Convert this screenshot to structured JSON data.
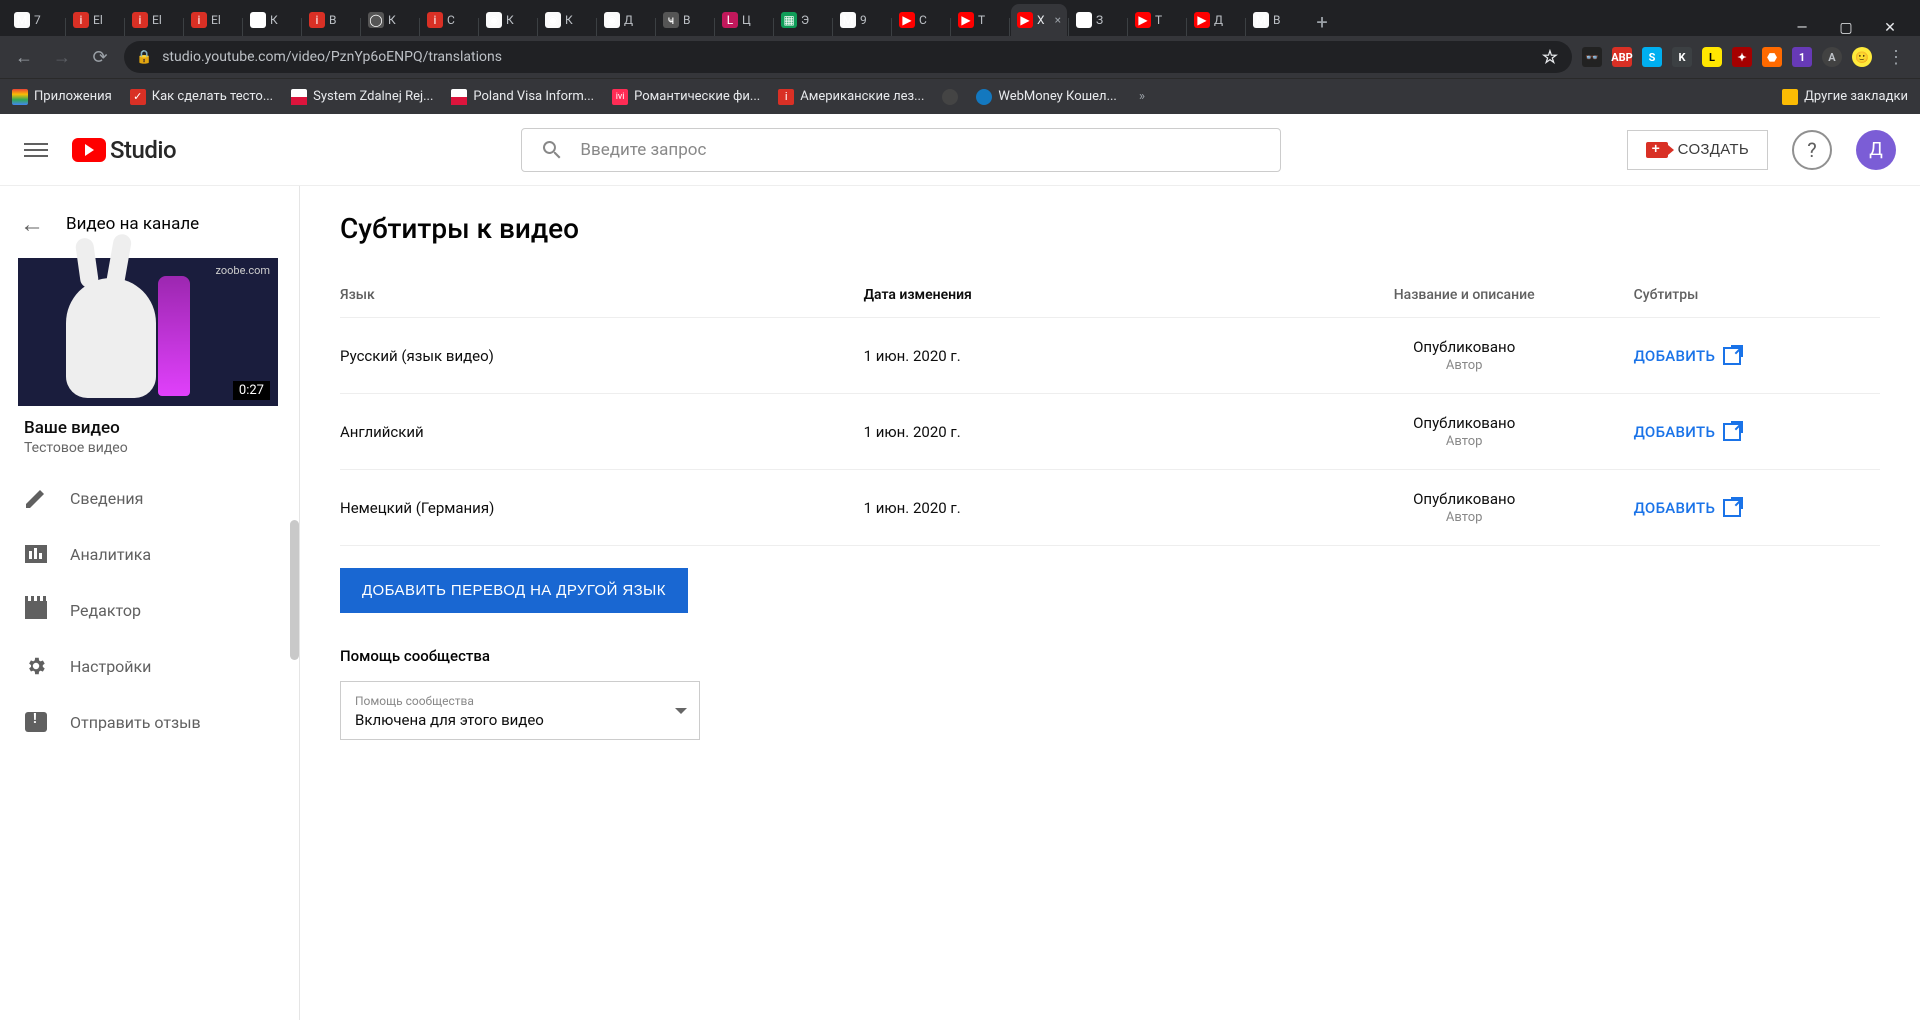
{
  "chrome": {
    "tabs": [
      {
        "fav": "M",
        "color": "#fff",
        "bg": "#fafafa",
        "label": "7"
      },
      {
        "fav": "i",
        "bg": "#d93025",
        "label": "El"
      },
      {
        "fav": "i",
        "bg": "#d93025",
        "label": "El"
      },
      {
        "fav": "i",
        "bg": "#d93025",
        "label": "El"
      },
      {
        "fav": "M",
        "bg": "#fff",
        "label": "К"
      },
      {
        "fav": "i",
        "bg": "#d93025",
        "label": "В"
      },
      {
        "fav": "◯",
        "bg": "#555",
        "label": "К"
      },
      {
        "fav": "i",
        "bg": "#d93025",
        "label": "С"
      },
      {
        "fav": "◉",
        "bg": "#fafafa",
        "label": "К"
      },
      {
        "fav": "◉",
        "bg": "#fafafa",
        "label": "К"
      },
      {
        "fav": "◉",
        "bg": "#fafafa",
        "label": "Д"
      },
      {
        "fav": "ҹ",
        "bg": "#555",
        "label": "В"
      },
      {
        "fav": "L",
        "bg": "#c2185b",
        "label": "Ц"
      },
      {
        "fav": "▦",
        "bg": "#0f9d58",
        "label": "Э"
      },
      {
        "fav": "M",
        "bg": "#fafafa",
        "label": "9"
      },
      {
        "fav": "▶",
        "bg": "#ff0000",
        "label": "С"
      },
      {
        "fav": "▶",
        "bg": "#ff0000",
        "label": "T"
      },
      {
        "fav": "▶",
        "bg": "#ff0000",
        "label": "X",
        "active": true
      },
      {
        "fav": "G",
        "bg": "#fff",
        "label": "З"
      },
      {
        "fav": "▶",
        "bg": "#ff0000",
        "label": "Т"
      },
      {
        "fav": "▶",
        "bg": "#ff0000",
        "label": "Д"
      },
      {
        "fav": "M",
        "bg": "#fafafa",
        "label": "В"
      }
    ],
    "url": "studio.youtube.com/video/PznYp6oENPQ/translations",
    "bookmarks": {
      "apps": "Приложения",
      "items": [
        {
          "icon": "check",
          "label": "Как сделать тесто..."
        },
        {
          "icon": "pl",
          "label": "System Zdalnej Rej..."
        },
        {
          "icon": "pl",
          "label": "Poland Visa Inform..."
        },
        {
          "icon": "ivi",
          "label": "Романтические фи..."
        },
        {
          "icon": "i",
          "label": "Американские лез..."
        },
        {
          "icon": "globe",
          "label": ""
        },
        {
          "icon": "wm",
          "label": "WebMoney Кошел..."
        }
      ],
      "more": "»",
      "other": "Другие закладки"
    }
  },
  "header": {
    "studio": "Studio",
    "search_placeholder": "Введите запрос",
    "create": "СОЗДАТЬ",
    "avatar": "Д"
  },
  "sidebar": {
    "back": "Видео на канале",
    "thumb_watermark": "zoobe.com",
    "thumb_duration": "0:27",
    "your_video": "Ваше видео",
    "video_title": "Тестовое видео",
    "items": [
      "Сведения",
      "Аналитика",
      "Редактор",
      "Настройки",
      "Отправить отзыв"
    ]
  },
  "page": {
    "title": "Субтитры к видео",
    "columns": {
      "lang": "Язык",
      "date": "Дата изменения",
      "title_desc": "Название и описание",
      "subs": "Субтитры"
    },
    "rows": [
      {
        "lang": "Русский (язык видео)",
        "date": "1 июн. 2020 г.",
        "status": "Опубликовано",
        "by": "Автор",
        "action": "ДОБАВИТЬ"
      },
      {
        "lang": "Английский",
        "date": "1 июн. 2020 г.",
        "status": "Опубликовано",
        "by": "Автор",
        "action": "ДОБАВИТЬ"
      },
      {
        "lang": "Немецкий (Германия)",
        "date": "1 июн. 2020 г.",
        "status": "Опубликовано",
        "by": "Автор",
        "action": "ДОБАВИТЬ"
      }
    ],
    "add_lang_btn": "ДОБАВИТЬ ПЕРЕВОД НА ДРУГОЙ ЯЗЫК",
    "community_h": "Помощь сообщества",
    "community_label": "Помощь сообщества",
    "community_value": "Включена для этого видео"
  }
}
